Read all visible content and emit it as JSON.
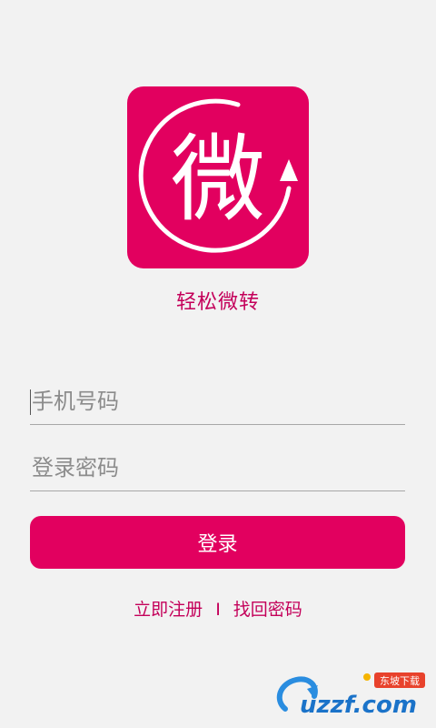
{
  "app": {
    "name": "轻松微转",
    "logo_char": "微"
  },
  "login_form": {
    "phone_placeholder": "手机号码",
    "password_placeholder": "登录密码",
    "login_label": "登录"
  },
  "links": {
    "register_label": "立即注册",
    "separator": "I",
    "forgot_label": "找回密码"
  },
  "watermark": {
    "text": "uzzf.com",
    "tag": "东坡下载"
  },
  "colors": {
    "brand": "#e2005f",
    "link": "#c4005a",
    "background": "#f2f2f2"
  }
}
